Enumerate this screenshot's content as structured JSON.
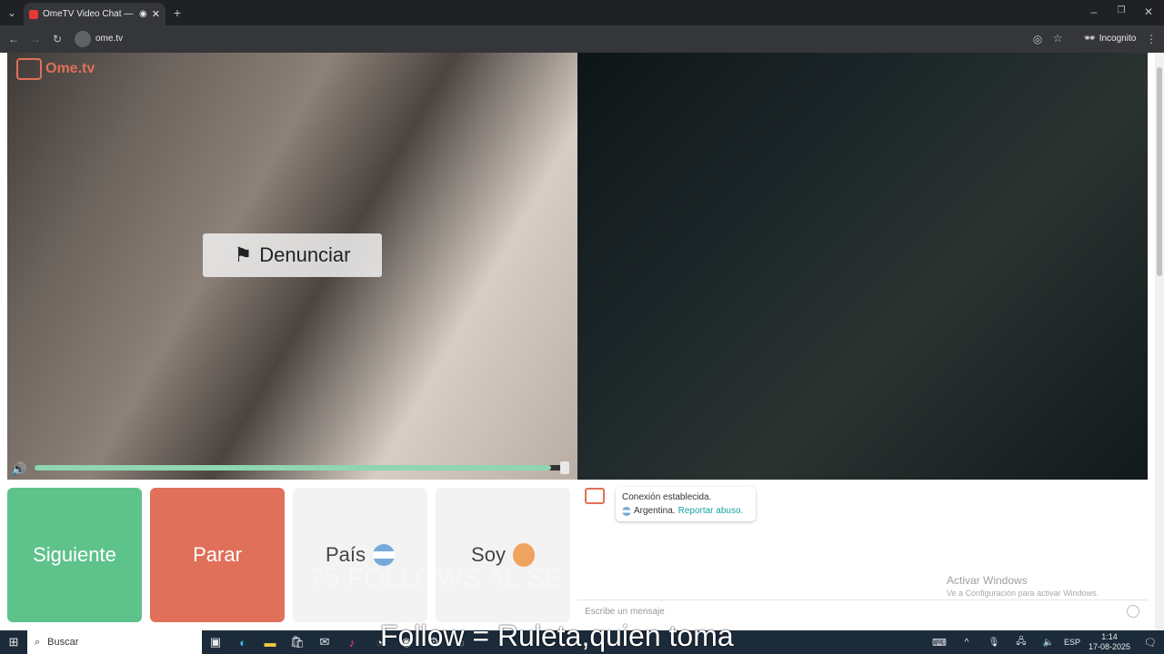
{
  "browser": {
    "tab_title": "OmeTV Video Chat — Ome",
    "url": "ome.tv",
    "incognito_label": "Incognito"
  },
  "page": {
    "logo_text": "Ome.tv",
    "report_button": "Denunciar",
    "volume_level": 0.97,
    "buttons": {
      "next": "Siguiente",
      "stop": "Parar",
      "country": "País",
      "gender": "Soy"
    },
    "chat": {
      "connection_text": "Conexión establecida.",
      "country_text": "Argentina.",
      "report_link": "Reportar abuso.",
      "message_placeholder": "Escribe un mensaje"
    },
    "watermark": {
      "line1": "Activar Windows",
      "line2": "Ve a Configuración para activar Windows."
    },
    "overlay_text_1": "75 FOLLOWS AL SE",
    "overlay_text_2": "Follow = Ruleta,quien toma"
  },
  "taskbar": {
    "search_label": "Buscar",
    "lang": "ESP",
    "time": "1:14",
    "date": "17-08-2025"
  },
  "colors": {
    "next_green": "#5ec28b",
    "stop_red": "#e0705a",
    "link_teal": "#1aa3a0",
    "volume_green": "#8fd6b2"
  }
}
